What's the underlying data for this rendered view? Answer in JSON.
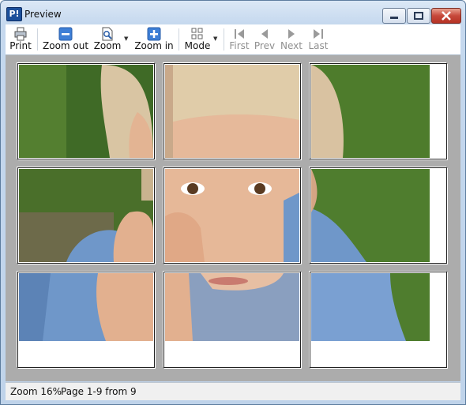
{
  "window": {
    "title": "Preview",
    "app_icon": "P!"
  },
  "toolbar": {
    "print": "Print",
    "zoom_out": "Zoom out",
    "zoom": "Zoom",
    "zoom_in": "Zoom in",
    "mode": "Mode",
    "first": "First",
    "prev": "Prev",
    "next": "Next",
    "last": "Last"
  },
  "status": {
    "zoom": "Zoom 16%",
    "pages": "Page 1-9 from 9"
  },
  "colors": {
    "grass": "#4f7a2a",
    "shirt": "#6f97c9",
    "skin": "#e2b08f",
    "hair": "#d8c3a2",
    "background": "#acacac"
  }
}
